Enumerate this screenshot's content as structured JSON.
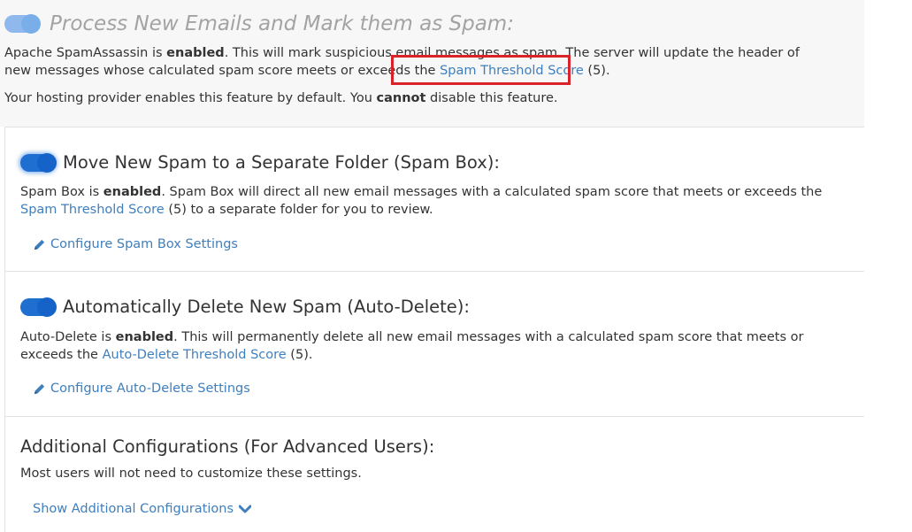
{
  "process": {
    "title": "Process New Emails and Mark them as Spam:",
    "line1_a": "Apache SpamAssassin is ",
    "line1_bold": "enabled",
    "line1_b": ". This will mark suspicious email messages as spam. The server will update the header of new messages whose calculated spam score meets or exceeds the ",
    "threshold_link": "Spam Threshold Score",
    "threshold_value": " (5).",
    "line2_a": "Your hosting provider enables this feature by default. You ",
    "line2_bold": "cannot",
    "line2_b": " disable this feature."
  },
  "spambox": {
    "title": "Move New Spam to a Separate Folder (Spam Box):",
    "desc_a": "Spam Box is ",
    "desc_bold": "enabled",
    "desc_b": ". Spam Box will direct all new email messages with a calculated spam score that meets or exceeds the ",
    "desc_link": "Spam Threshold Score",
    "desc_c": " (5) to a separate folder for you to review.",
    "configure_label": "Configure Spam Box Settings"
  },
  "autodelete": {
    "title": "Automatically Delete New Spam (Auto-Delete):",
    "desc_a": "Auto-Delete is ",
    "desc_bold": "enabled",
    "desc_b": ". This will permanently delete all new email messages with a calculated spam score that meets or exceeds the ",
    "desc_link": "Auto-Delete Threshold Score",
    "desc_c": " (5).",
    "configure_label": "Configure Auto-Delete Settings"
  },
  "additional": {
    "title": "Additional Configurations (For Advanced Users):",
    "desc": "Most users will not need to customize these settings.",
    "show_label": "Show Additional Configurations"
  },
  "icons": {
    "edit": "pencil-icon",
    "expand": "chevron-down-icon"
  },
  "colors": {
    "toggle_on": "#1e6fd0",
    "link": "#3f7fbd",
    "highlight": "#d8232a"
  }
}
